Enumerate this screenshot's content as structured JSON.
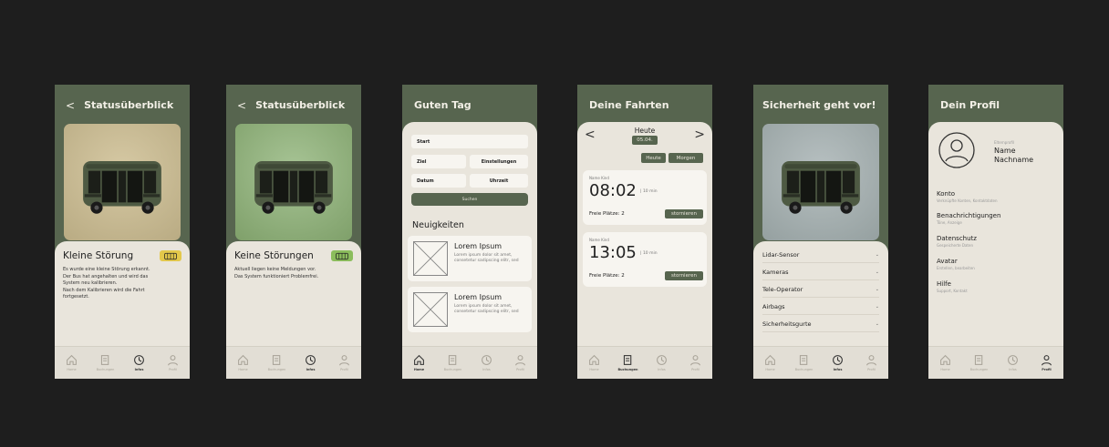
{
  "colors": {
    "background": "#1e1e1e",
    "header_green": "#57654f",
    "panel_beige": "#e9e5dc",
    "warning_yellow": "#e3c84b",
    "ok_green": "#8bbd5c"
  },
  "nav_labels": {
    "home": "Home",
    "bookings": "Buchungen",
    "infos": "Infos",
    "profile": "Profil"
  },
  "screen1": {
    "header": "Statusüberblick",
    "status_title": "Kleine Störung",
    "status_icon": "bus-icon",
    "description": [
      "Es wurde eine kleine Störung erkannt.",
      "Der Bus hat angehalten und wird das",
      "System neu kalibrieren.",
      "Nach dem Kalibrieren wird die Fahrt",
      "fortgesetzt."
    ]
  },
  "screen2": {
    "header": "Statusüberblick",
    "status_title": "Keine Störungen",
    "status_icon": "bus-icon",
    "description": [
      "Aktuell liegen keine Meldungen vor.",
      "Das System funktioniert Problemfrei."
    ]
  },
  "screen3": {
    "header": "Guten Tag",
    "start": "Start",
    "ziel": "Ziel",
    "einstellungen": "Einstellungen",
    "datum": "Datum",
    "uhrzeit": "Uhrzeit",
    "search_button": "Suchen",
    "news_title": "Neuigkeiten",
    "news": [
      {
        "title": "Lorem Ipsum",
        "text": "Lorem ipsum dolor sit amet, consetetur sadipscing elitr, sed"
      },
      {
        "title": "Lorem Ipsum",
        "text": "Lorem ipsum dolor sit amet, consetetur sadipscing elitr, sed"
      }
    ]
  },
  "screen4": {
    "header": "Deine Fahrten",
    "day_label": "Heute",
    "date": "05.04.",
    "btn_today": "Heute",
    "btn_tomorrow": "Morgen",
    "rides": [
      {
        "child": "Name Kind",
        "time": "08:02",
        "duration": "| 10 min",
        "seats": "Freie Plätze: 2",
        "cancel": "stornieren"
      },
      {
        "child": "Name Kind",
        "time": "13:05",
        "duration": "| 10 min",
        "seats": "Freie Plätze: 2",
        "cancel": "stornieren"
      }
    ]
  },
  "screen5": {
    "header": "Sicherheit geht vor!",
    "items": [
      "Lidar-Sensor",
      "Kameras",
      "Tele-Operator",
      "Airbags",
      "Sicherheitsgurte"
    ]
  },
  "screen6": {
    "header": "Dein Profil",
    "elternprofil": "Elternprofil",
    "name": "Name",
    "nachname": "Nachname",
    "items": [
      {
        "title": "Konto",
        "sub": "Verknüpfte Konten, Kontaktdaten"
      },
      {
        "title": "Benachrichtigungen",
        "sub": "Töne, Anzeige"
      },
      {
        "title": "Datenschutz",
        "sub": "Gespeicherte Daten"
      },
      {
        "title": "Avatar",
        "sub": "Erstellen, bearbeiten"
      },
      {
        "title": "Hilfe",
        "sub": "Support, Kontakt"
      }
    ]
  }
}
